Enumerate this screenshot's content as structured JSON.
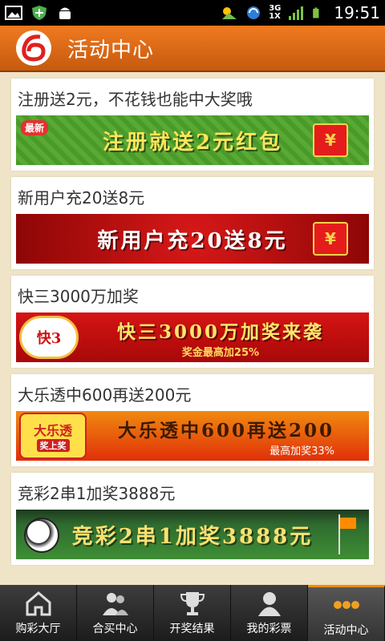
{
  "status_bar": {
    "time": "19:51",
    "network_type_top": "3G",
    "network_type_bottom": "1X",
    "icons": [
      "image-icon",
      "shield-icon",
      "android-icon",
      "weather-icon",
      "sync-icon",
      "signal-icon",
      "battery-icon"
    ]
  },
  "header": {
    "title": "活动中心",
    "logo": "lottery-logo"
  },
  "promotions": [
    {
      "title": "注册送2元，不花钱也能中大奖哦",
      "banner_text": "注册就送2元红包",
      "badge": "最新"
    },
    {
      "title": "新用户充20送8元",
      "banner_text": "新用户充20送8元"
    },
    {
      "title": "快三3000万加奖",
      "banner_text": "快三3000万加奖来袭",
      "banner_sub": "奖金最高加25%",
      "logo_text": "快3"
    },
    {
      "title": "大乐透中600再送200元",
      "banner_text": "大乐透中600再送200",
      "banner_sub": "最高加奖33%",
      "logo_text": "大乐透",
      "logo_sub": "奖上奖"
    },
    {
      "title": "竞彩2串1加奖3888元",
      "banner_text": "竞彩2串1加奖3888元"
    }
  ],
  "bottom_nav": {
    "items": [
      {
        "label": "购彩大厅",
        "icon": "home-icon"
      },
      {
        "label": "合买中心",
        "icon": "group-icon"
      },
      {
        "label": "开奖结果",
        "icon": "trophy-icon"
      },
      {
        "label": "我的彩票",
        "icon": "user-icon"
      },
      {
        "label": "活动中心",
        "icon": "more-icon"
      }
    ],
    "active_index": 4
  },
  "colors": {
    "header": "#e0701a",
    "background": "#efe3c8",
    "accent": "#f08a10"
  }
}
